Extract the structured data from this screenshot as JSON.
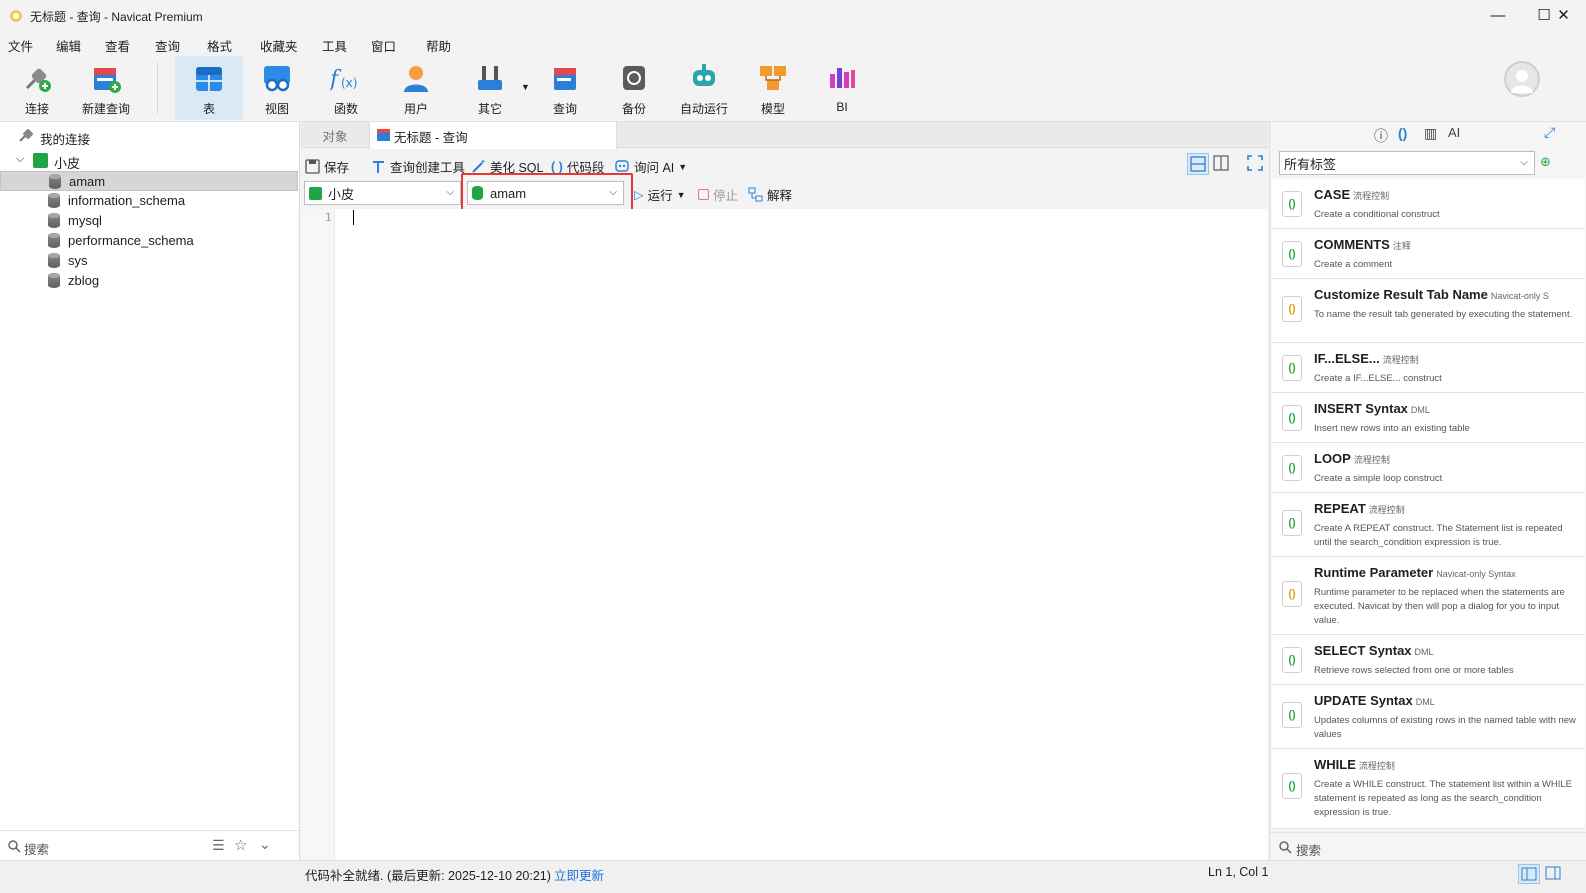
{
  "window": {
    "title": "无标题 - 查询 - Navicat Premium"
  },
  "menu": [
    "文件",
    "编辑",
    "查看",
    "查询",
    "格式",
    "收藏夹",
    "工具",
    "窗口",
    "帮助"
  ],
  "toolbar": {
    "connect": "连接",
    "new_query": "新建查询",
    "table": "表",
    "view": "视图",
    "function": "函数",
    "user": "用户",
    "other": "其它",
    "query": "查询",
    "backup": "备份",
    "automation": "自动运行",
    "model": "模型",
    "bi": "BI"
  },
  "sidebar": {
    "root": "我的连接",
    "connection": "小皮",
    "databases": [
      "amam",
      "information_schema",
      "mysql",
      "performance_schema",
      "sys",
      "zblog"
    ],
    "search_placeholder": "搜索"
  },
  "tabs": {
    "objects": "对象",
    "query_tab": "无标题 - 查询"
  },
  "query_toolbar": {
    "save": "保存",
    "builder": "查询创建工具",
    "beautify": "美化 SQL",
    "snippet": "代码段",
    "ask_ai": "询问 AI"
  },
  "query_toolbar2": {
    "connection": "小皮",
    "database": "amam",
    "run": "运行",
    "stop": "停止",
    "explain": "解释"
  },
  "editor": {
    "line_number": "1"
  },
  "snippets_panel": {
    "filter": "所有标签",
    "search_placeholder": "搜索",
    "items": [
      {
        "title": "CASE",
        "tag": "流程控制",
        "desc": "Create a conditional construct"
      },
      {
        "title": "COMMENTS",
        "tag": "注释",
        "desc": "Create a comment"
      },
      {
        "title": "Customize Result Tab Name",
        "tag": "Navicat-only S",
        "desc": "To name the result tab generated by executing the statement."
      },
      {
        "title": "IF...ELSE...",
        "tag": "流程控制",
        "desc": "Create a IF...ELSE... construct"
      },
      {
        "title": "INSERT Syntax",
        "tag": "DML",
        "desc": "Insert new rows into an existing table"
      },
      {
        "title": "LOOP",
        "tag": "流程控制",
        "desc": "Create a simple loop construct"
      },
      {
        "title": "REPEAT",
        "tag": "流程控制",
        "desc": "Create A REPEAT construct. The Statement list is repeated until the search_condition expression is true."
      },
      {
        "title": "Runtime Parameter",
        "tag": "Navicat-only Syntax",
        "desc": "Runtime parameter to be replaced when the statements are executed. Navicat by then will pop a dialog for you to input value."
      },
      {
        "title": "SELECT Syntax",
        "tag": "DML",
        "desc": "Retrieve rows selected from one or more tables"
      },
      {
        "title": "UPDATE Syntax",
        "tag": "DML",
        "desc": "Updates columns of existing rows in the named table with new values"
      },
      {
        "title": "WHILE",
        "tag": "流程控制",
        "desc": "Create a WHILE construct. The statement list within a WHILE statement is repeated as long as the search_condition expression is true."
      }
    ]
  },
  "statusbar": {
    "message": "代码补全就绪. (最后更新: 2025-12-10 20:21)",
    "update_link": "立即更新",
    "position": "Ln 1, Col 1"
  },
  "colors": {
    "accent": "#1a73d9",
    "highlight_box": "#e53935",
    "selected_row": "#d6d6d6"
  }
}
